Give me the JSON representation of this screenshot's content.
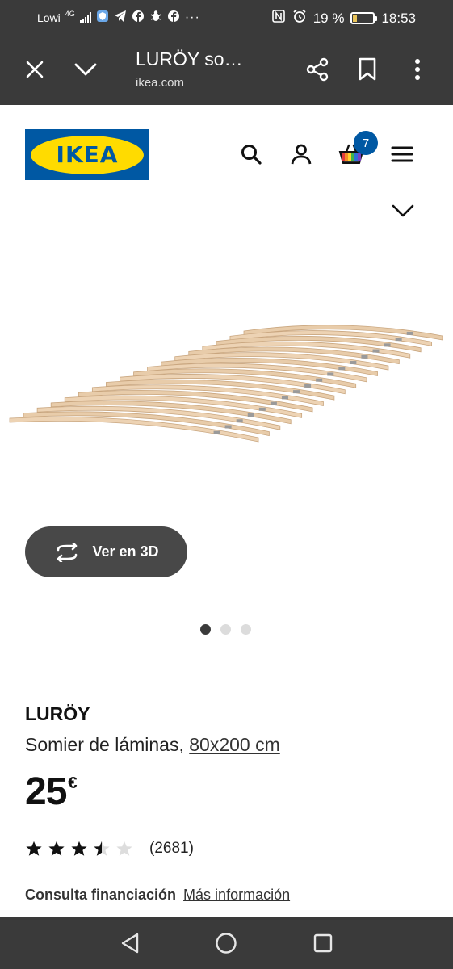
{
  "status_bar": {
    "carrier": "Lowi",
    "network": "4G",
    "battery_percent": "19 %",
    "battery_level": 0.19,
    "time": "18:53",
    "icons": [
      "signal-icon",
      "shield-icon",
      "telegram-icon",
      "facebook-icon",
      "bug-icon",
      "facebook-icon",
      "more-notifications-icon",
      "nfc-icon",
      "alarm-icon",
      "battery-icon"
    ]
  },
  "browser": {
    "page_title": "LURÖY so…",
    "domain": "ikea.com",
    "icons": [
      "close-icon",
      "chevron-down-icon",
      "share-icon",
      "bookmark-icon",
      "more-vert-icon"
    ]
  },
  "header": {
    "logo_text": "IKEA",
    "cart_count": "7",
    "icons": [
      "search-icon",
      "account-icon",
      "cart-icon",
      "menu-icon"
    ],
    "colors": {
      "brand_blue": "#0058a3",
      "brand_yellow": "#ffdb00"
    }
  },
  "gallery": {
    "view_3d_label": "Ver en 3D",
    "slide_count": 3,
    "active_slide": 1
  },
  "product": {
    "name": "LURÖY",
    "description": "Somier de láminas,",
    "size_link": "80x200 cm",
    "price": "25",
    "currency": "€",
    "rating": 3.5,
    "rating_max": 5,
    "review_count": "(2681)",
    "financing_label": "Consulta financiación",
    "financing_link": "Más información"
  },
  "nav_bar": {
    "icons": [
      "back-icon",
      "home-icon",
      "recents-icon"
    ]
  }
}
